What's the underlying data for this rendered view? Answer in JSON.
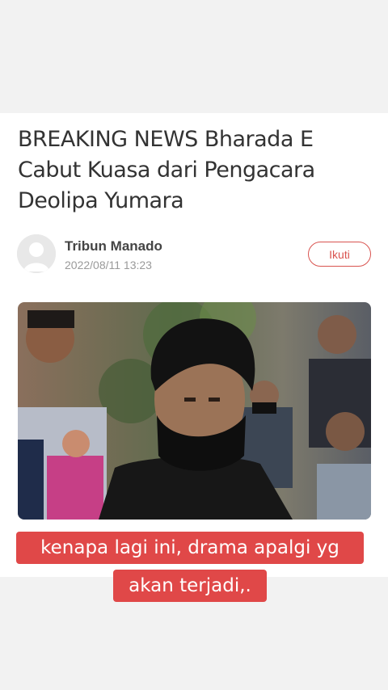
{
  "article": {
    "headline": "BREAKING NEWS Bharada E Cabut Kuasa dari Pengacara Deolipa Yumara",
    "headline_lines": [
      "BREAKING NEWS Bharada E",
      "Cabut Kuasa dari Pengacara",
      "Deolipa Yumara"
    ]
  },
  "author": {
    "name": "Tribun Manado",
    "date": "2022/08/11 13:23",
    "follow_label": "Ikuti"
  },
  "caption": {
    "line1": "kenapa lagi ini, drama apalgi yg",
    "line2": "akan terjadi,."
  },
  "colors": {
    "accent": "#e04848",
    "follow": "#d9534f"
  }
}
